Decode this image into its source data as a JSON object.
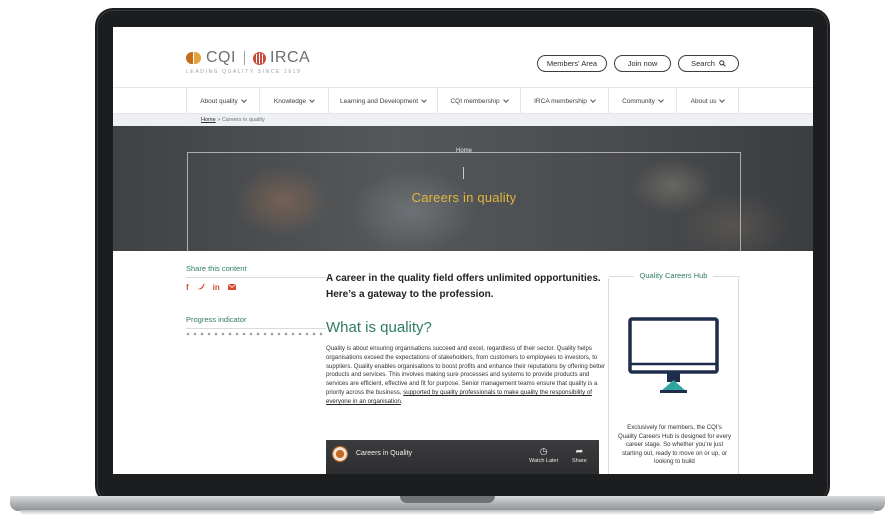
{
  "header": {
    "logo_text_left": "CQI",
    "logo_text_right": "IRCA",
    "tagline": "LEADING QUALITY SINCE 1919",
    "members_area": "Members' Area",
    "join_now": "Join now",
    "search": "Search"
  },
  "nav": {
    "items": [
      {
        "label": "About quality"
      },
      {
        "label": "Knowledge"
      },
      {
        "label": "Learning and Development"
      },
      {
        "label": "CQI membership"
      },
      {
        "label": "IRCA membership"
      },
      {
        "label": "Community"
      },
      {
        "label": "About us"
      }
    ]
  },
  "breadcrumb": {
    "home": "Home",
    "separator": ">",
    "current": "Careers in quality"
  },
  "hero": {
    "home": "Home",
    "separator": "|",
    "title": "Careers in quality"
  },
  "sidebar": {
    "share_label": "Share this content",
    "social": [
      "f",
      "♦",
      "in",
      "✉"
    ],
    "progress_label": "Progress indicator"
  },
  "main": {
    "intro": "A career in the quality field offers unlimited opportunities.  Here’s a gateway to the profession.",
    "heading": "What is quality?",
    "body_plain": "Quality is about ensuring organisations succeed and excel, regardless of their sector. Quality helps organisations exceed the expectations of stakeholders, from customers to employees to investors, to suppliers. Quality enables organisations to boost profits and enhance their reputations by offering better products and services. This involves making sure processes and systems to provide products and services are efficient, effective and fit for purpose. Senior management teams ensure that quality is a priority across the business, ",
    "body_link": "supported by quality professionals to make quality the responsibility of everyone in an organisation",
    "body_end": "."
  },
  "video": {
    "title": "Careers in Quality",
    "watch_later": "Watch Later",
    "share": "Share"
  },
  "hub": {
    "title": "Quality Careers Hub",
    "text": "Exclusively for members, the CQI's Quality Careers Hub is designed for every career stage. So whether you're just starting out, ready to move on or up, or looking to build",
    "icon": "monitor-icon"
  },
  "colors": {
    "accent_green": "#2e7d5b",
    "hero_gold": "#e2b53b",
    "social_red": "#d44b33",
    "monitor_navy": "#1f2d4d",
    "monitor_teal": "#2fa7a0"
  }
}
